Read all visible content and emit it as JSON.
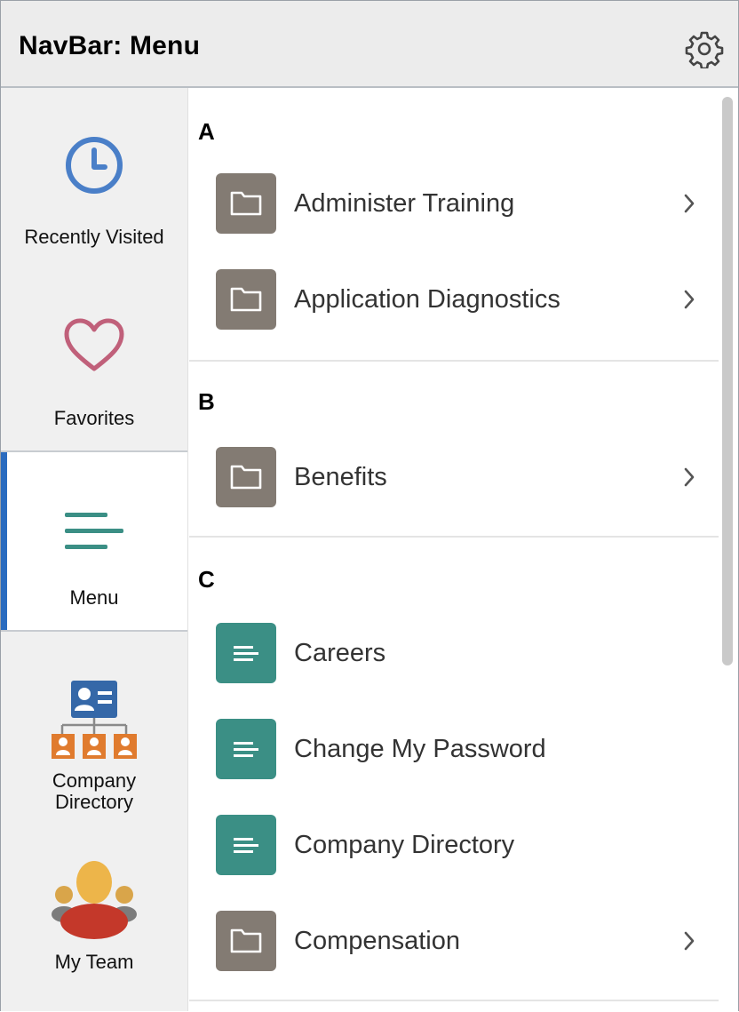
{
  "header": {
    "title": "NavBar: Menu",
    "settings_icon": "gear-icon"
  },
  "sidebar": {
    "items": [
      {
        "label": "Recently Visited",
        "icon": "clock-icon"
      },
      {
        "label": "Favorites",
        "icon": "heart-icon"
      },
      {
        "label": "Menu",
        "icon": "menu-lines-icon",
        "active": true
      },
      {
        "label_line1": "Company",
        "label_line2": "Directory",
        "icon": "org-chart-icon"
      },
      {
        "label": "My Team",
        "icon": "team-icon"
      }
    ]
  },
  "menu": {
    "sections": [
      {
        "letter": "A",
        "items": [
          {
            "label": "Administer Training",
            "type": "folder"
          },
          {
            "label": "Application Diagnostics",
            "type": "folder"
          }
        ]
      },
      {
        "letter": "B",
        "items": [
          {
            "label": "Benefits",
            "type": "folder"
          }
        ]
      },
      {
        "letter": "C",
        "items": [
          {
            "label": "Careers",
            "type": "page"
          },
          {
            "label": "Change My Password",
            "type": "page"
          },
          {
            "label": "Company Directory",
            "type": "page"
          },
          {
            "label": "Compensation",
            "type": "folder"
          }
        ]
      }
    ]
  },
  "colors": {
    "folder_tile": "#837b73",
    "page_tile": "#3b8f85",
    "active_indicator": "#2a6bbf",
    "clock_blue": "#4a7fc8",
    "heart_pink": "#c0607a"
  }
}
